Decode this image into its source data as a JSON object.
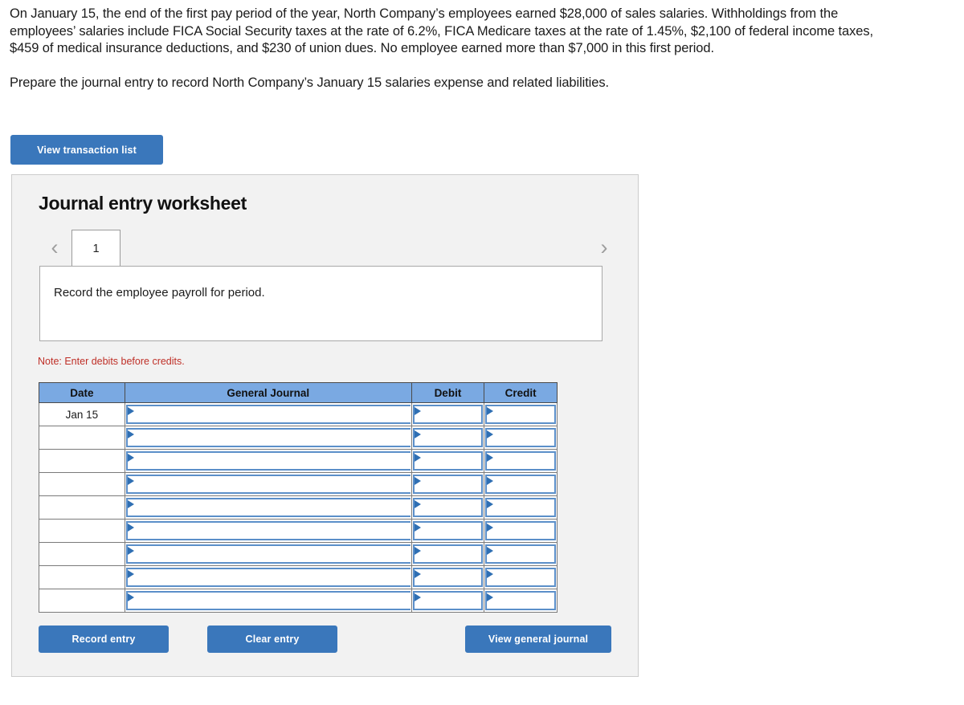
{
  "problem": {
    "paragraph1": "On January 15, the end of the first pay period of the year, North Company’s employees earned $28,000 of sales salaries. Withholdings from the employees’ salaries include FICA Social Security taxes at the rate of 6.2%, FICA Medicare taxes at the rate of 1.45%, $2,100 of federal income taxes, $459 of medical insurance deductions, and $230 of union dues. No employee earned more than $7,000 in this first period.",
    "paragraph2": "Prepare the journal entry to record North Company’s January 15 salaries expense and related liabilities."
  },
  "buttons": {
    "view_transaction_list": "View transaction list",
    "record_entry": "Record entry",
    "clear_entry": "Clear entry",
    "view_general_journal": "View general journal"
  },
  "worksheet": {
    "title": "Journal entry worksheet",
    "prev_chevron": "‹",
    "next_chevron": "›",
    "tabs": [
      {
        "label": "1",
        "active": true
      }
    ],
    "description": "Record the employee payroll for period.",
    "note": "Note: Enter debits before credits."
  },
  "journal_table": {
    "columns": [
      "Date",
      "General Journal",
      "Debit",
      "Credit"
    ],
    "rows": [
      {
        "date": "Jan 15",
        "journal": "",
        "debit": "",
        "credit": ""
      },
      {
        "date": "",
        "journal": "",
        "debit": "",
        "credit": ""
      },
      {
        "date": "",
        "journal": "",
        "debit": "",
        "credit": ""
      },
      {
        "date": "",
        "journal": "",
        "debit": "",
        "credit": ""
      },
      {
        "date": "",
        "journal": "",
        "debit": "",
        "credit": ""
      },
      {
        "date": "",
        "journal": "",
        "debit": "",
        "credit": ""
      },
      {
        "date": "",
        "journal": "",
        "debit": "",
        "credit": ""
      },
      {
        "date": "",
        "journal": "",
        "debit": "",
        "credit": ""
      },
      {
        "date": "",
        "journal": "",
        "debit": "",
        "credit": ""
      }
    ]
  },
  "colors": {
    "button_blue": "#3a77bb",
    "header_blue": "#7aa9e2",
    "input_border_blue": "#5b8fc9",
    "caret_blue": "#2f6fb3",
    "note_red": "#bf2f27",
    "panel_bg": "#f2f2f2"
  }
}
